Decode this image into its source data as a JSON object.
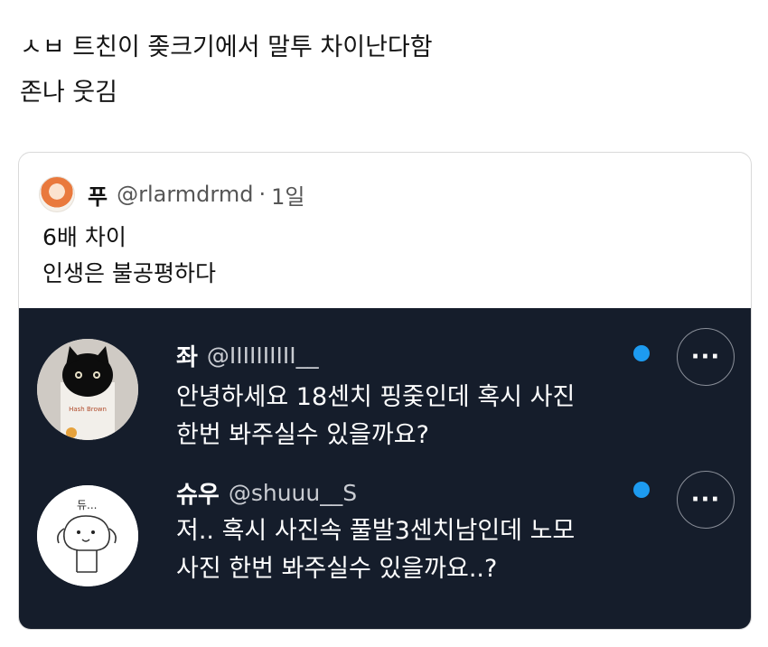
{
  "post": {
    "line1": "ㅅㅂ 트친이 좆크기에서 말투 차이난다함",
    "line2": "존나 웃김"
  },
  "quote": {
    "name": "푸",
    "handle": "@rlarmdrmd",
    "separator": "·",
    "time": "1일",
    "body_line1": "6배 차이",
    "body_line2": "인생은 불공평하다"
  },
  "replies": [
    {
      "name": "좌",
      "handle": "@IIIIIIIIII__",
      "text_line1": "안녕하세요 18센치 핑줒인데 혹시 사진",
      "text_line2": "한번 봐주실수 있을까요?",
      "more_label": "···",
      "avatar_caption": "Hash Brown",
      "avatar": "black-cat-avatar"
    },
    {
      "name": "슈우",
      "handle": "@shuuu__S",
      "text_line1": "저.. 혹시 사진속 풀발3센치남인데 노모",
      "text_line2": "사진 한번 봐주실수 있을까요..?",
      "more_label": "···",
      "avatar_caption": "듀...",
      "avatar": "dog-doodle-avatar"
    }
  ],
  "colors": {
    "dark_panel": "#151d2b",
    "unread_dot": "#1d9bf0"
  }
}
